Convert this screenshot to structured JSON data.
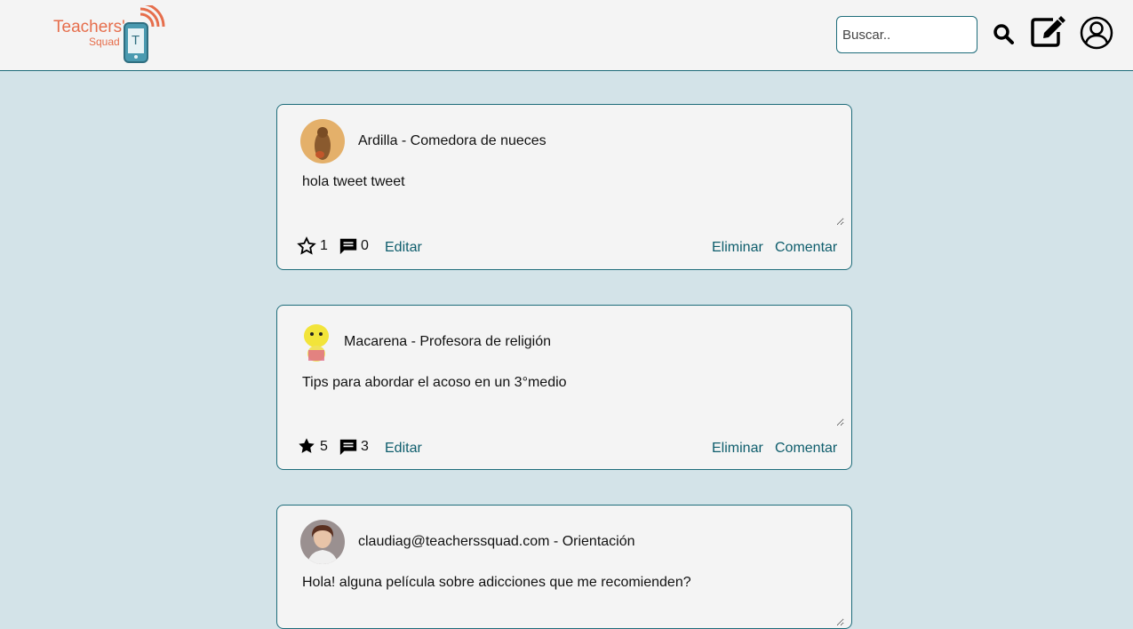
{
  "header": {
    "logo": {
      "title": "Teachers'",
      "subtitle": "Squad",
      "badge_letter": "T"
    },
    "search": {
      "placeholder": "Buscar..",
      "value": ""
    },
    "icons": [
      "search-icon",
      "edit-icon",
      "user-profile-icon"
    ]
  },
  "posts": [
    {
      "author": "Ardilla - Comedora de nueces",
      "text": "hola tweet tweet",
      "likes": "1",
      "liked": false,
      "comments": "0",
      "edit_label": "Editar",
      "delete_label": "Eliminar",
      "comment_label": "Comentar"
    },
    {
      "author": "Macarena - Profesora de religión",
      "text": "Tips para abordar el acoso en un 3°medio",
      "likes": "5",
      "liked": true,
      "comments": "3",
      "edit_label": "Editar",
      "delete_label": "Eliminar",
      "comment_label": "Comentar"
    },
    {
      "author": "claudiag@teacherssquad.com - Orientación",
      "text": "Hola! alguna película sobre adicciones que me recomienden?"
    }
  ],
  "colors": {
    "accent": "#1d6c7a",
    "link": "#0e5d6c",
    "logo": "#e66e4c",
    "background": "#d3e3e8",
    "card": "#f4f4f4"
  }
}
